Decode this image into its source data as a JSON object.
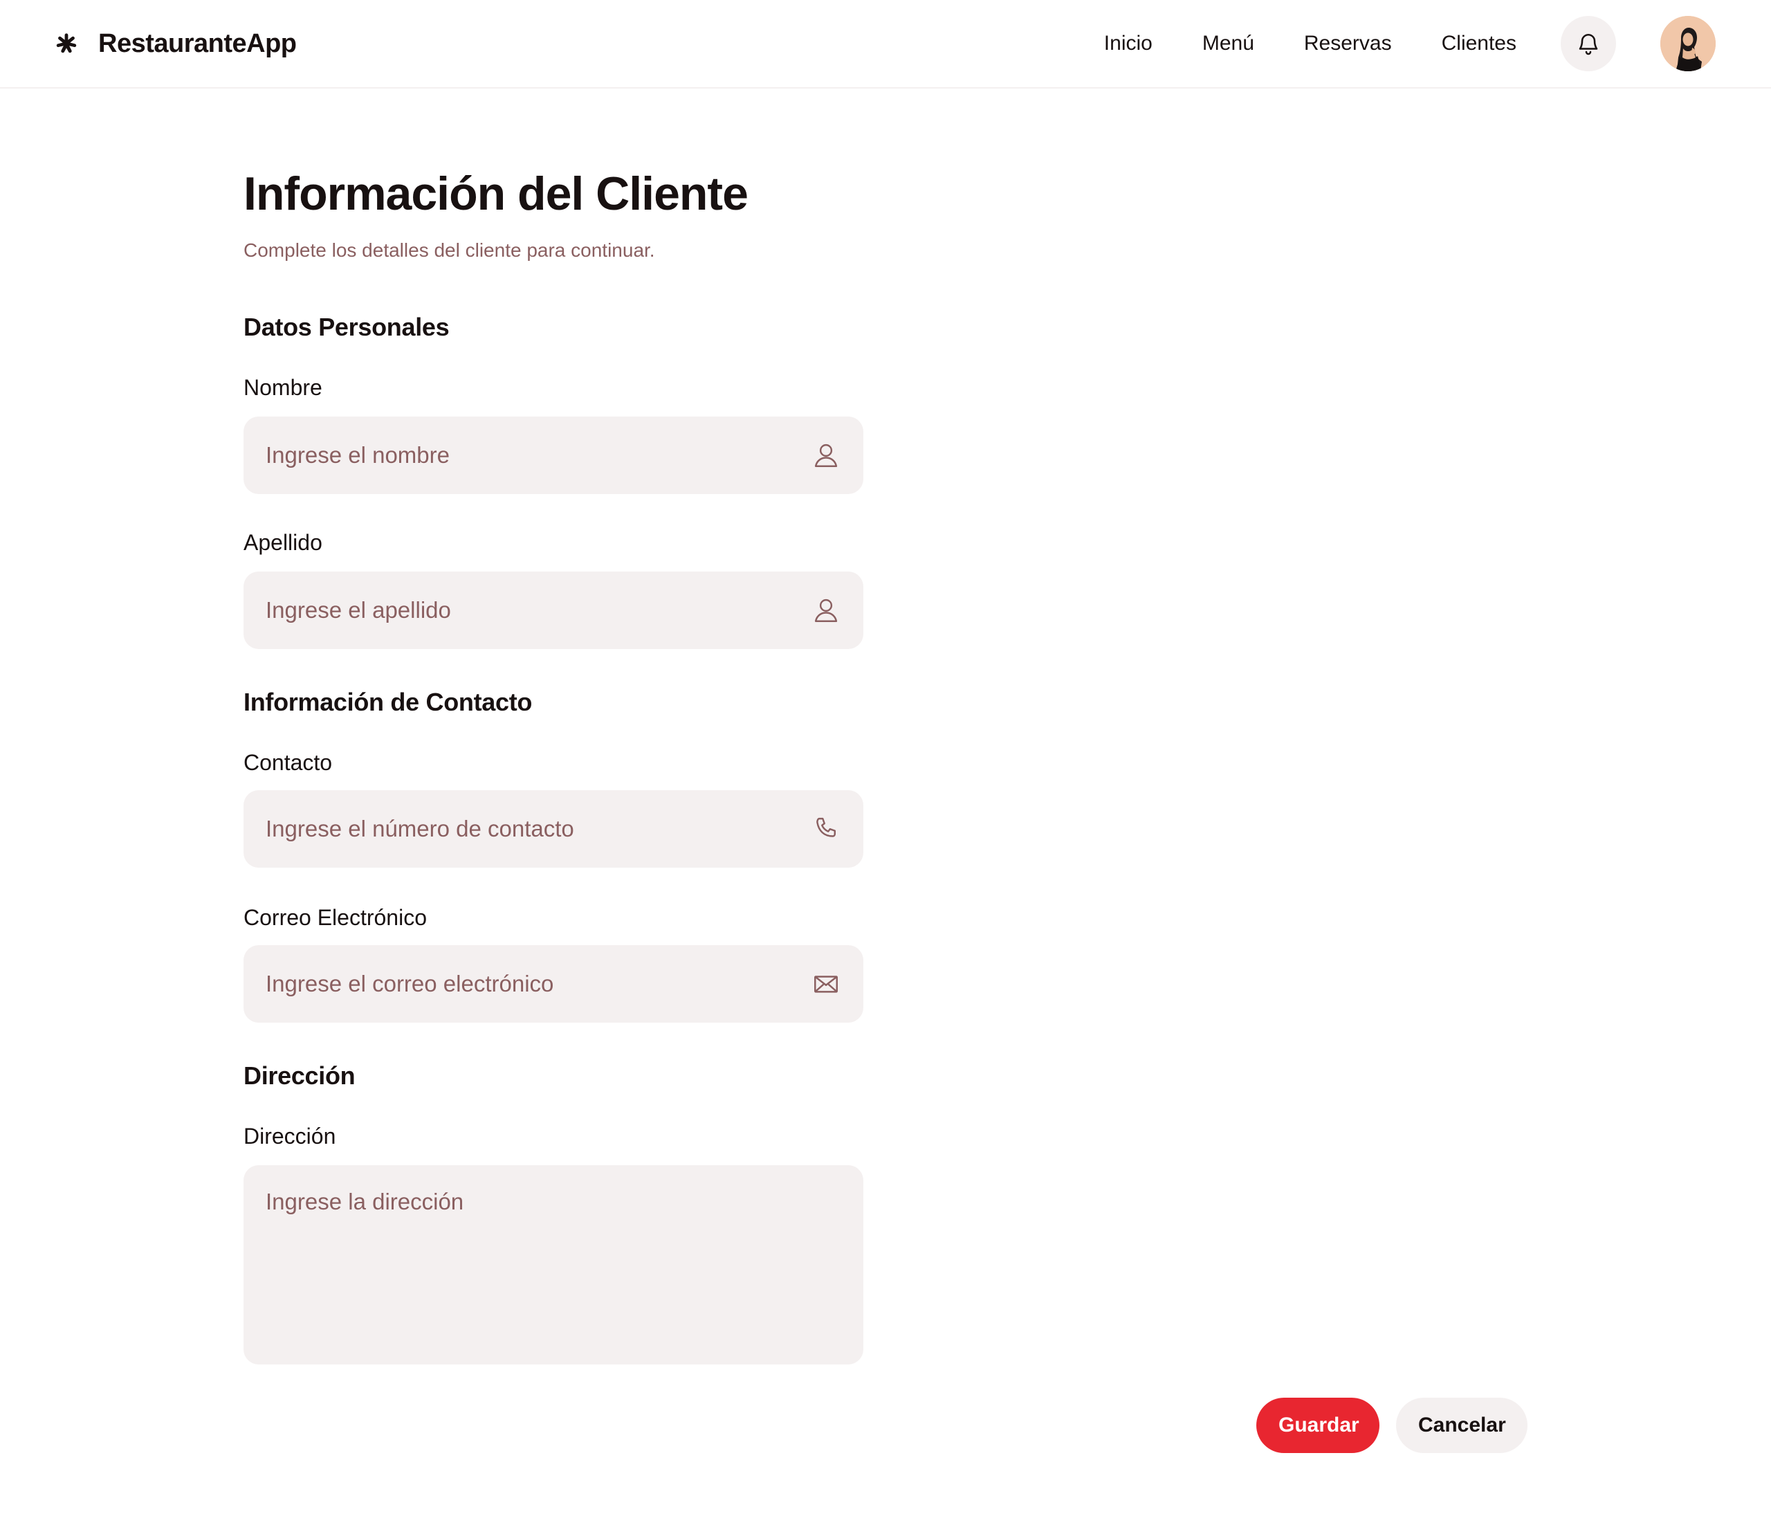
{
  "app": {
    "name": "RestauranteApp",
    "logo_icon": "asterisk-logo-icon"
  },
  "nav": {
    "items": [
      {
        "label": "Inicio"
      },
      {
        "label": "Menú"
      },
      {
        "label": "Reservas"
      },
      {
        "label": "Clientes"
      }
    ],
    "notifications_icon": "bell-icon",
    "avatar": "user-avatar"
  },
  "page": {
    "title": "Información del Cliente",
    "subtitle": "Complete los detalles del cliente para continuar."
  },
  "sections": {
    "personal": {
      "title": "Datos Personales",
      "first_name": {
        "label": "Nombre",
        "placeholder": "Ingrese el nombre",
        "value": "",
        "icon": "user-icon"
      },
      "last_name": {
        "label": "Apellido",
        "placeholder": "Ingrese el apellido",
        "value": "",
        "icon": "user-icon"
      }
    },
    "contact": {
      "title": "Información de Contacto",
      "phone": {
        "label": "Contacto",
        "placeholder": "Ingrese el número de contacto",
        "value": "",
        "icon": "phone-icon"
      },
      "email": {
        "label": "Correo Electrónico",
        "placeholder": "Ingrese el correo electrónico",
        "value": "",
        "icon": "mail-icon"
      }
    },
    "address": {
      "title": "Dirección",
      "address": {
        "label": "Dirección",
        "placeholder": "Ingrese la dirección",
        "value": ""
      }
    }
  },
  "actions": {
    "save_label": "Guardar",
    "cancel_label": "Cancelar"
  },
  "colors": {
    "primary": "#e82630",
    "text": "#181111",
    "muted": "#8a5f60",
    "input_bg": "#f4f0f0"
  }
}
